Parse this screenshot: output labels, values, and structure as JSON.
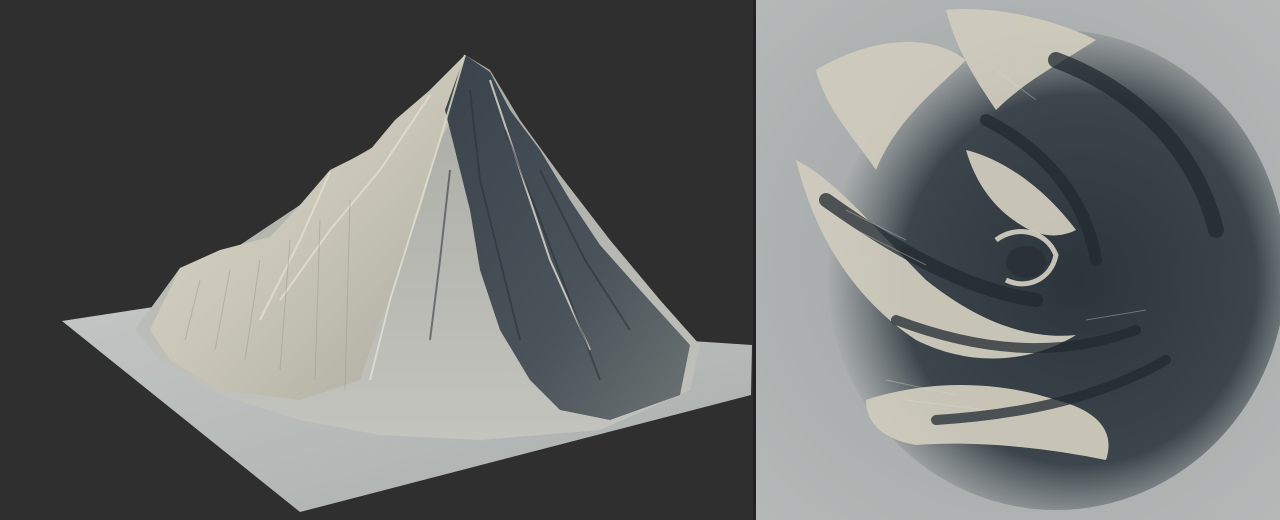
{
  "colors": {
    "background": "#2f2f2f",
    "divider": "#232323",
    "terrain_lit": "#cfccbf",
    "terrain_mid": "#8a8d88",
    "terrain_shadow": "#2f3740",
    "ground_plane": "#b9bcbb",
    "topdown_base": "#aeb2b2"
  },
  "viewports": {
    "left": {
      "view": "perspective",
      "subject": "terrain-mesh"
    },
    "right": {
      "view": "top-down",
      "subject": "terrain-heightmap"
    }
  }
}
